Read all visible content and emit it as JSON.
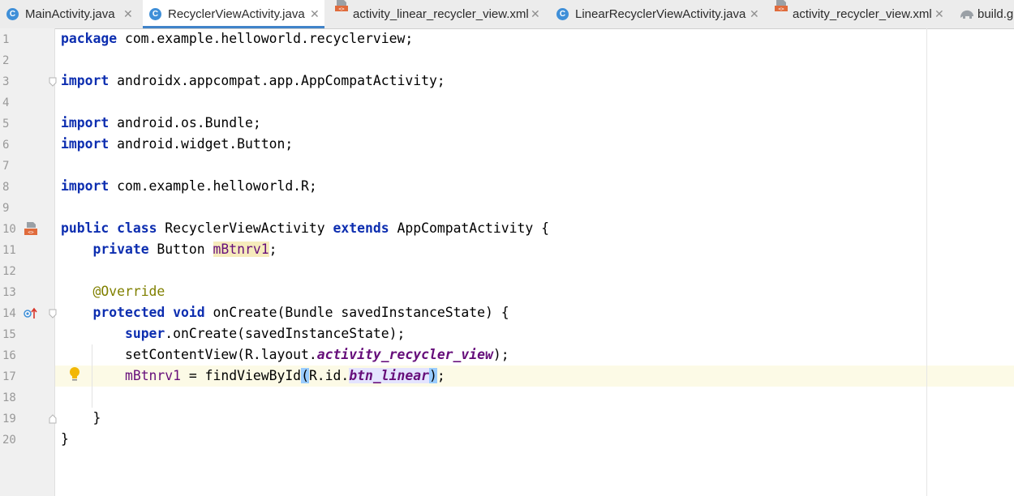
{
  "tabs": [
    {
      "label": "MainActivity.java",
      "type": "class",
      "active": false
    },
    {
      "label": "RecyclerViewActivity.java",
      "type": "class",
      "active": true
    },
    {
      "label": "activity_linear_recycler_view.xml",
      "type": "xml",
      "active": false
    },
    {
      "label": "LinearRecyclerViewActivity.java",
      "type": "class",
      "active": false
    },
    {
      "label": "activity_recycler_view.xml",
      "type": "xml",
      "active": false
    },
    {
      "label": "build.g",
      "type": "gradle",
      "active": false
    }
  ],
  "tab_close_glyph": "✕",
  "class_icon_letter": "C",
  "editor": {
    "current_line": 17,
    "line_numbers": [
      "1",
      "2",
      "3",
      "4",
      "5",
      "6",
      "7",
      "8",
      "9",
      "10",
      "11",
      "12",
      "13",
      "14",
      "15",
      "16",
      "17",
      "18",
      "19",
      "20"
    ],
    "code": {
      "l1_kw": "package",
      "l1_rest": " com.example.helloworld.recyclerview;",
      "l3_kw": "import",
      "l3_rest": " androidx.appcompat.app.AppCompatActivity;",
      "l5_kw": "import",
      "l5_rest": " android.os.Bundle;",
      "l6_kw": "import",
      "l6_rest": " android.widget.Button;",
      "l8_kw": "import",
      "l8_rest": " com.example.helloworld.R;",
      "l10_kw1": "public",
      "l10_kw2": "class",
      "l10_name": " RecyclerViewActivity ",
      "l10_kw3": "extends",
      "l10_rest": " AppCompatActivity {",
      "l11_kw": "private",
      "l11_type": " Button ",
      "l11_field": "mBtnrv1",
      "l11_end": ";",
      "l13_ann": "@Override",
      "l14_kw1": "protected",
      "l14_kw2": "void",
      "l14_rest": " onCreate(Bundle savedInstanceState) {",
      "l15_kw": "super",
      "l15_rest": ".onCreate(savedInstanceState);",
      "l16_pre": "setContentView(R.layout.",
      "l16_ref": "activity_recycler_view",
      "l16_end": ");",
      "l17_field": "mBtnrv1",
      "l17_mid": " = findViewById",
      "l17_open": "(",
      "l17_r": "R.id.",
      "l17_ref": "btn_linear",
      "l17_close": ")",
      "l17_end": ";",
      "l19_brace": "}",
      "l20_brace": "}"
    }
  },
  "colors": {
    "keyword": "#0d2eb0",
    "annotation": "#808000",
    "field": "#660e7a",
    "current_line_bg": "#fcfae6",
    "class_icon": "#3f8fd8",
    "active_tab_underline": "#4083c9"
  },
  "gutter_icons": [
    "layout-xml-icon",
    "override-method-icon",
    "intention-bulb-icon"
  ]
}
